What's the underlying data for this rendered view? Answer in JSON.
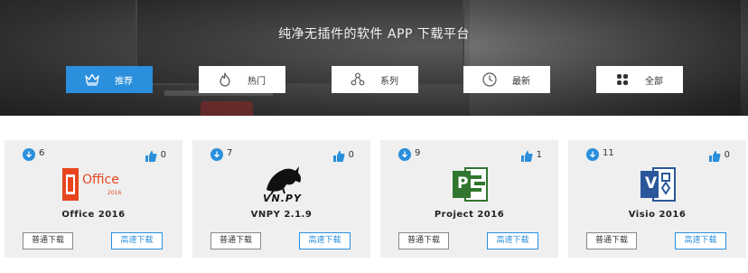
{
  "hero": {
    "title": "纯净无插件的软件 APP 下载平台"
  },
  "tabs": [
    {
      "label": "推荐",
      "icon": "crown-icon",
      "active": true
    },
    {
      "label": "热门",
      "icon": "flame-icon",
      "active": false
    },
    {
      "label": "系列",
      "icon": "series-nodes-icon",
      "active": false
    },
    {
      "label": "最新",
      "icon": "clock-icon",
      "active": false
    },
    {
      "label": "全部",
      "icon": "grid-icon",
      "active": false
    }
  ],
  "cards": [
    {
      "name": "Office 2016",
      "downloads": "6",
      "likes": "0",
      "normal_download": "普通下载",
      "fast_download": "高速下载",
      "logo_text": "Office",
      "logo_sub": "2016"
    },
    {
      "name": "VNPY 2.1.9",
      "downloads": "7",
      "likes": "0",
      "normal_download": "普通下载",
      "fast_download": "高速下载",
      "logo_text": "VN.PY"
    },
    {
      "name": "Project 2016",
      "downloads": "9",
      "likes": "1",
      "normal_download": "普通下载",
      "fast_download": "高速下载",
      "logo_text": "P"
    },
    {
      "name": "Visio 2016",
      "downloads": "11",
      "likes": "0",
      "normal_download": "普通下载",
      "fast_download": "高速下载",
      "logo_text": "V"
    }
  ],
  "colors": {
    "accent": "#2a8fdc",
    "office_orange": "#e8451f",
    "project_green": "#31752f",
    "visio_blue": "#2b579a"
  }
}
